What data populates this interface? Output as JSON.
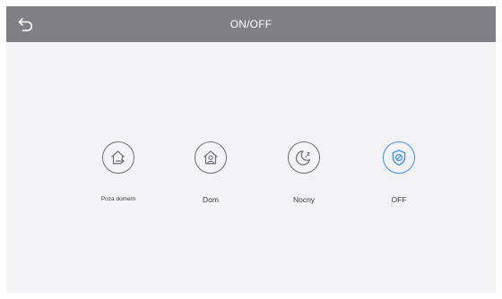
{
  "header": {
    "title": "ON/OFF",
    "back_icon": "back-arrow-icon"
  },
  "modes": [
    {
      "label": "Poza domem",
      "icon": "house-exit-icon",
      "active": false
    },
    {
      "label": "Dom",
      "icon": "house-person-icon",
      "active": false
    },
    {
      "label": "Nocny",
      "icon": "moon-sleep-icon",
      "active": false
    },
    {
      "label": "OFF",
      "icon": "shield-off-icon",
      "active": true
    }
  ],
  "colors": {
    "header_bg": "#7f7f85",
    "screen_bg": "#f3f3f5",
    "icon_gray": "#6e6e73",
    "accent": "#3d8fe6"
  }
}
